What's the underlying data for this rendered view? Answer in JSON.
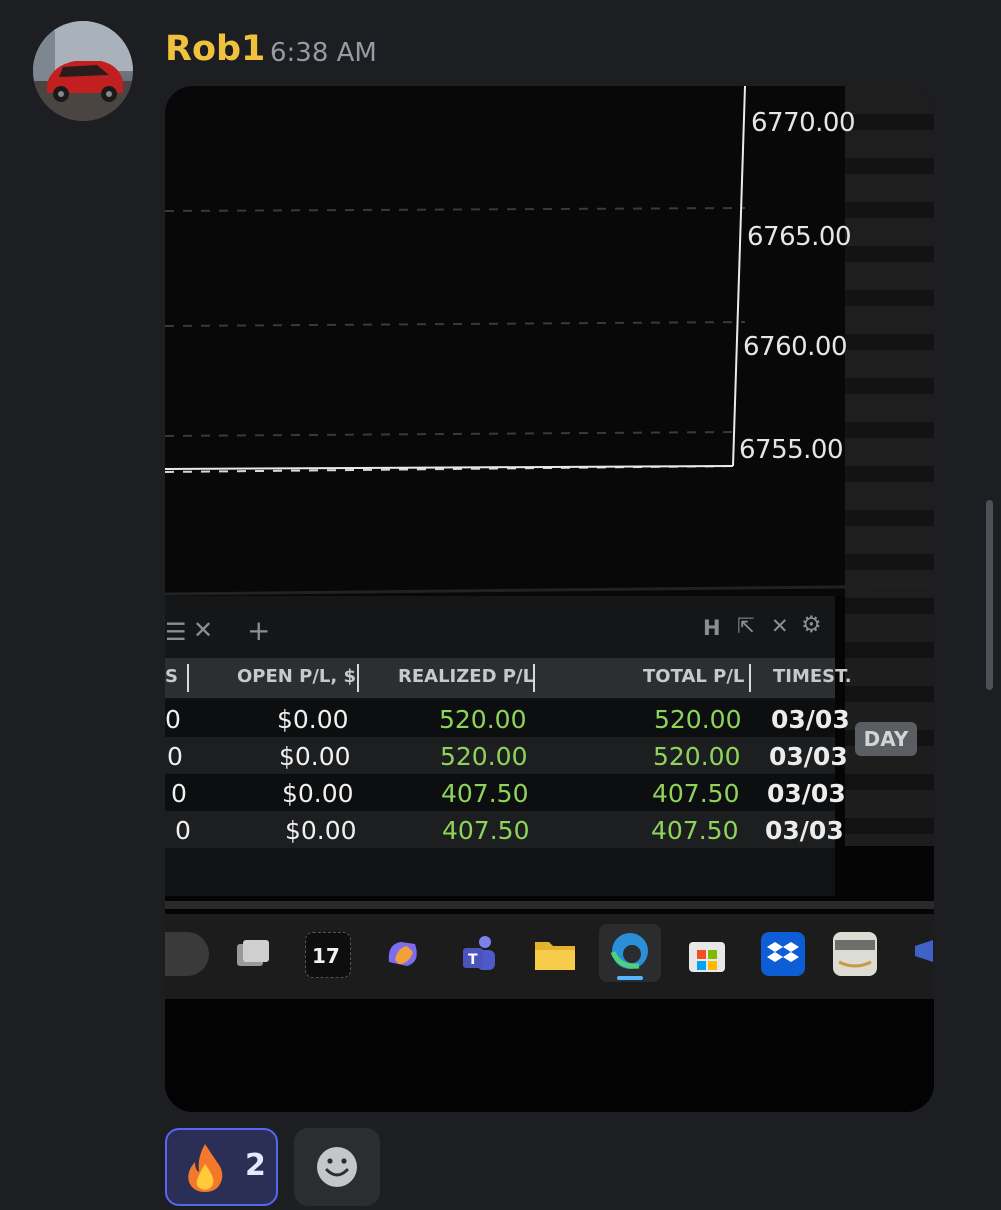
{
  "message": {
    "author": "Rob1",
    "timestamp": "6:38 AM",
    "author_color": "#f0c13d"
  },
  "photo": {
    "price_axis": [
      "6770.00",
      "6765.00",
      "6760.00",
      "6755.00"
    ],
    "panel": {
      "columns": [
        "S",
        "OPEN P/L, $",
        "REALIZED P/L",
        "TOTAL P/L",
        "TIMEST."
      ],
      "rows": [
        {
          "qty": "0",
          "open_pl": "$0.00",
          "realized_pl": "520.00",
          "total_pl": "520.00",
          "date": "03/03"
        },
        {
          "qty": "0",
          "open_pl": "$0.00",
          "realized_pl": "520.00",
          "total_pl": "520.00",
          "date": "03/03"
        },
        {
          "qty": "0",
          "open_pl": "$0.00",
          "realized_pl": "407.50",
          "total_pl": "407.50",
          "date": "03/03"
        },
        {
          "qty": "0",
          "open_pl": "$0.00",
          "realized_pl": "407.50",
          "total_pl": "407.50",
          "date": "03/03"
        }
      ],
      "tab_controls": [
        "H"
      ],
      "badge": "DAY"
    },
    "taskbar_icons": [
      "task-view-icon",
      "tradingview-icon",
      "copilot-icon",
      "teams-icon",
      "file-explorer-icon",
      "edge-icon",
      "store-icon",
      "dropbox-icon",
      "amazon-icon"
    ]
  },
  "reactions": [
    {
      "emoji": "fire",
      "count": "2"
    }
  ],
  "colors": {
    "background": "#1d1e22",
    "profit_green": "#8fd45a",
    "reaction_active": "#5865f2"
  }
}
